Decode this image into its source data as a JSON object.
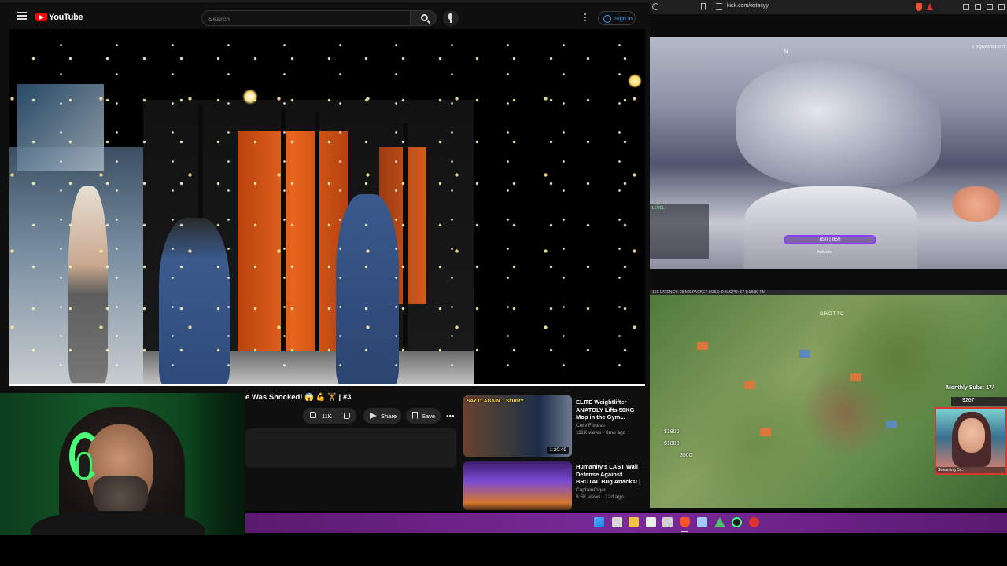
{
  "youtube": {
    "brand": "YouTube",
    "search_placeholder": "Search",
    "sign_in": "Sign in",
    "video": {
      "title": "e Was Shocked! 😱 💪 🏋 | #3",
      "likes": "11K",
      "share_label": "Share",
      "save_label": "Save"
    },
    "recommended": [
      {
        "title": "ELITE Weightlifter ANATOLY Lifts 50KG Mop in the Gym... ",
        "channel": "Core Fitness",
        "meta": "111K views · 8mo ago",
        "duration": "1:20:49",
        "thumb_text": "SAY IT AGAIN... SORRY"
      },
      {
        "title": "Humanity's LAST Wall Defense Against BRUTAL Bug Attacks! | ...",
        "channel": "CaptainCigar",
        "meta": "9.5K views · 12d ago"
      }
    ]
  },
  "browser": {
    "url": "kick.com/extexyy"
  },
  "stream_top": {
    "compass": "N",
    "squads_left": "6 SQUADS LEFT",
    "shield_value": "850 | 850",
    "activate_label": "Activate",
    "level_label": "LEVEL"
  },
  "stream_bottom": {
    "stats_bar": "161  LATENCY: 28 MS  PACKET LOSS: 0 %  GPU: 67  1:18:30 PM",
    "place_label": "GROTTO",
    "money": [
      "$1800",
      "$1800",
      "$500"
    ],
    "subs_label": "Monthly Subs: 17/",
    "subs_count": "9267",
    "cam_label": "Streaming Dr..."
  },
  "taskbar": {
    "icons": [
      "windows-start",
      "task-view",
      "file-explorer",
      "notepad",
      "store",
      "brave",
      "calendar",
      "app-a",
      "razer",
      "chrome"
    ]
  }
}
